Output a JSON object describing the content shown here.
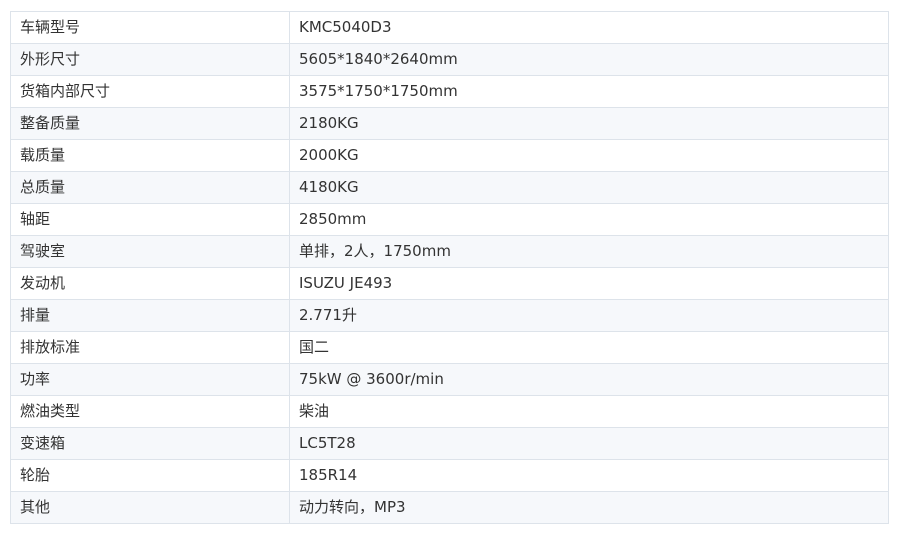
{
  "specs": {
    "rows": [
      {
        "label": "车辆型号",
        "value": "KMC5040D3"
      },
      {
        "label": "外形尺寸",
        "value": "5605*1840*2640mm"
      },
      {
        "label": "货箱内部尺寸",
        "value": "3575*1750*1750mm"
      },
      {
        "label": "整备质量",
        "value": "2180KG"
      },
      {
        "label": "载质量",
        "value": "2000KG"
      },
      {
        "label": "总质量",
        "value": "4180KG"
      },
      {
        "label": "轴距",
        "value": "2850mm"
      },
      {
        "label": "驾驶室",
        "value": "单排，2人，1750mm"
      },
      {
        "label": "发动机",
        "value": "ISUZU JE493"
      },
      {
        "label": "排量",
        "value": "2.771升"
      },
      {
        "label": "排放标准",
        "value": "国二"
      },
      {
        "label": "功率",
        "value": "75kW @ 3600r/min"
      },
      {
        "label": "燃油类型",
        "value": "柴油"
      },
      {
        "label": "变速箱",
        "value": "LC5T28"
      },
      {
        "label": "轮胎",
        "value": "185R14"
      },
      {
        "label": "其他",
        "value": "动力转向，MP3"
      }
    ]
  },
  "colors": {
    "border": "#dde3ea",
    "row_alt_bg": "#f6f8fb",
    "text": "#333333"
  }
}
